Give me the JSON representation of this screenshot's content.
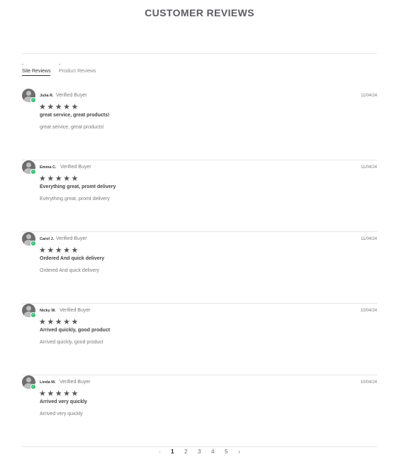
{
  "header": {
    "title": "CUSTOMER REVIEWS"
  },
  "tabs": [
    {
      "count": "-",
      "label": "Site Reviews",
      "active": true
    },
    {
      "count": "-",
      "label": "Product Reviews",
      "active": false
    }
  ],
  "reviews": [
    {
      "name": "Julia R.",
      "buyer_label": "Verified Buyer",
      "date": "11/04/24",
      "rating": 5,
      "stars": "★★★★★",
      "headline": "great service, great products!",
      "body": "great service, great products!"
    },
    {
      "name": "Emma C.",
      "buyer_label": "Verified Buyer",
      "date": "11/04/24",
      "rating": 5,
      "stars": "★★★★★",
      "headline": "Everything great, promt delivery",
      "body": "Everything great, promt delivery"
    },
    {
      "name": "Carol J.",
      "buyer_label": "Verified Buyer",
      "date": "11/04/24",
      "rating": 5,
      "stars": "★★★★★",
      "headline": "Ordered And quick delivery",
      "body": "Ordered And quick delivery"
    },
    {
      "name": "Nicky W.",
      "buyer_label": "Verified Buyer",
      "date": "10/04/24",
      "rating": 5,
      "stars": "★★★★★",
      "headline": "Arrived quickly, good product",
      "body": "Arrived quickly, good product"
    },
    {
      "name": "Linda M.",
      "buyer_label": "Verified Buyer",
      "date": "10/04/24",
      "rating": 5,
      "stars": "★★★★★",
      "headline": "Arrived very quickly",
      "body": "Arrived very quickly"
    }
  ],
  "pagination": {
    "prev_icon": "‹",
    "pages": [
      "1",
      "2",
      "3",
      "4",
      "5"
    ],
    "current": "1",
    "next_icon": "›"
  },
  "colors": {
    "verified_badge": "#2fbf71",
    "star": "#5a5a5a"
  }
}
